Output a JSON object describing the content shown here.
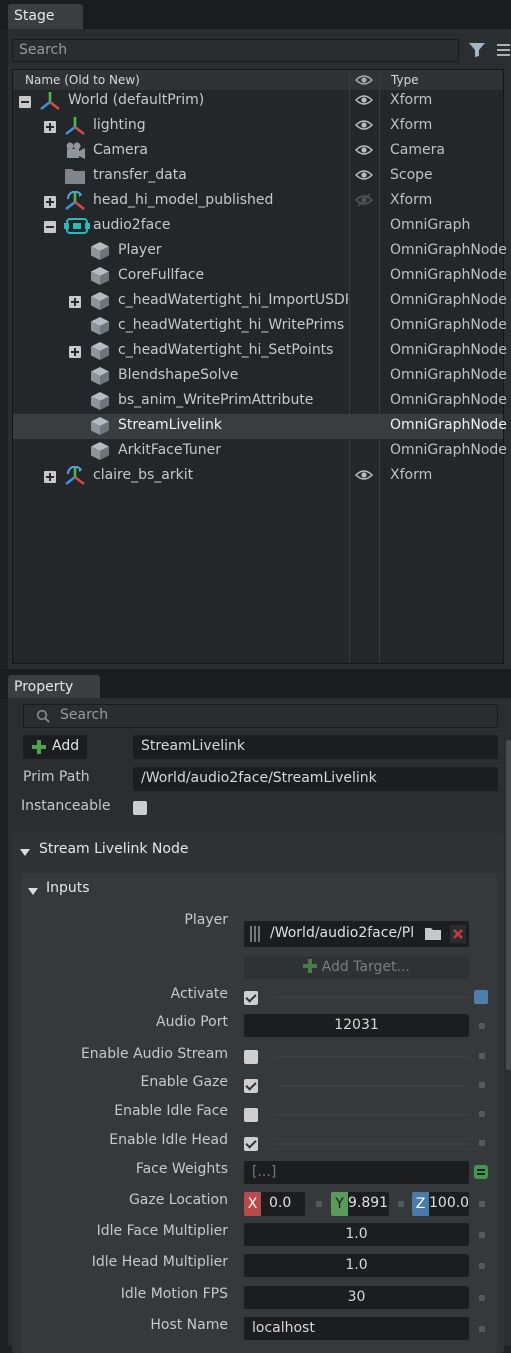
{
  "stage": {
    "tab_label": "Stage",
    "search_placeholder": "Search",
    "columns": {
      "name": "Name (Old to New)",
      "type": "Type"
    },
    "rows": [
      {
        "label": "World (defaultPrim)",
        "type": "Xform",
        "indent": 0,
        "expander": "minus",
        "icon": "xform-icon",
        "visible": true
      },
      {
        "label": "lighting",
        "type": "Xform",
        "indent": 1,
        "expander": "plus",
        "icon": "xform-icon",
        "visible": true
      },
      {
        "label": "Camera",
        "type": "Camera",
        "indent": 1,
        "expander": "",
        "icon": "camera-icon",
        "visible": true
      },
      {
        "label": "transfer_data",
        "type": "Scope",
        "indent": 1,
        "expander": "",
        "icon": "folder-icon",
        "visible": true
      },
      {
        "label": "head_hi_model_published",
        "type": "Xform",
        "indent": 1,
        "expander": "plus",
        "icon": "xform-icon",
        "visible": "hidden"
      },
      {
        "label": "audio2face",
        "type": "OmniGraph",
        "indent": 1,
        "expander": "minus",
        "icon": "omnigraph-icon",
        "visible": false
      },
      {
        "label": "Player",
        "type": "OmniGraphNode",
        "indent": 2,
        "expander": "",
        "icon": "node-cube-icon",
        "visible": false
      },
      {
        "label": "CoreFullface",
        "type": "OmniGraphNode",
        "indent": 2,
        "expander": "",
        "icon": "node-cube-icon",
        "visible": false
      },
      {
        "label": "c_headWatertight_hi_ImportUSDPr",
        "type": "OmniGraphNode",
        "indent": 2,
        "expander": "plus",
        "icon": "node-cube-icon",
        "visible": false
      },
      {
        "label": "c_headWatertight_hi_WritePrims",
        "type": "OmniGraphNode",
        "indent": 2,
        "expander": "",
        "icon": "node-cube-icon",
        "visible": false
      },
      {
        "label": "c_headWatertight_hi_SetPoints",
        "type": "OmniGraphNode",
        "indent": 2,
        "expander": "plus",
        "icon": "node-cube-icon",
        "visible": false
      },
      {
        "label": "BlendshapeSolve",
        "type": "OmniGraphNode",
        "indent": 2,
        "expander": "",
        "icon": "node-cube-icon",
        "visible": false
      },
      {
        "label": "bs_anim_WritePrimAttribute",
        "type": "OmniGraphNode",
        "indent": 2,
        "expander": "",
        "icon": "node-cube-icon",
        "visible": false
      },
      {
        "label": "StreamLivelink",
        "type": "OmniGraphNode",
        "indent": 2,
        "expander": "",
        "icon": "node-cube-icon",
        "visible": false,
        "selected": true
      },
      {
        "label": "ArkitFaceTuner",
        "type": "OmniGraphNode",
        "indent": 2,
        "expander": "",
        "icon": "node-cube-icon",
        "visible": false
      },
      {
        "label": "claire_bs_arkit",
        "type": "Xform",
        "indent": 1,
        "expander": "plus",
        "icon": "xform-icon",
        "visible": true
      }
    ]
  },
  "property": {
    "tab_label": "Property",
    "search_placeholder": "Search",
    "add_label": "Add",
    "prim_name": "StreamLivelink",
    "prim_path_label": "Prim Path",
    "prim_path": "/World/audio2face/StreamLivelink",
    "instanceable_label": "Instanceable",
    "node_section": "Stream Livelink Node",
    "inputs_section": "Inputs",
    "player_label": "Player",
    "player_path": "/World/audio2face/Pl",
    "add_target_label": "Add Target...",
    "activate_label": "Activate",
    "audio_port_label": "Audio Port",
    "audio_port": "12031",
    "enable_audio_stream_label": "Enable Audio Stream",
    "enable_gaze_label": "Enable Gaze",
    "enable_idle_face_label": "Enable Idle Face",
    "enable_idle_head_label": "Enable Idle Head",
    "face_weights_label": "Face Weights",
    "face_weights": "[...]",
    "gaze_location_label": "Gaze Location",
    "gaze_x_label": "X",
    "gaze_x": "0.0",
    "gaze_y_label": "Y",
    "gaze_y": "9.891",
    "gaze_z_label": "Z",
    "gaze_z": "100.0",
    "idle_face_mult_label": "Idle Face Multiplier",
    "idle_face_mult": "1.0",
    "idle_head_mult_label": "Idle Head Multiplier",
    "idle_head_mult": "1.0",
    "idle_fps_label": "Idle Motion FPS",
    "idle_fps": "30",
    "host_name_label": "Host Name",
    "host_name": "localhost"
  },
  "colors": {
    "accent_blue": "#4f7fa8",
    "x_red": "#b84a4a",
    "y_green": "#5a9a5a",
    "z_blue": "#4a7aaa"
  }
}
